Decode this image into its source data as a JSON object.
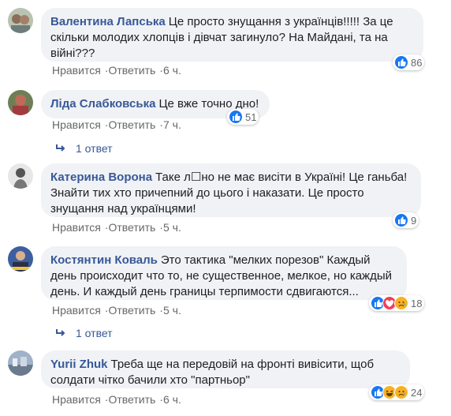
{
  "comments": [
    {
      "author": "Валентина Лапська",
      "text": "Це просто знущання з українців!!!!! За це скільки молодих хлопців і дівчат загинуло? На Майдані, та на війні???",
      "reactions_count": "86",
      "like_label": "Нравится",
      "reply_label": "Ответить",
      "time": "6 ч."
    },
    {
      "author": "Ліда Слабковська",
      "text": "Це вже точно дно!",
      "reactions_count": "51",
      "like_label": "Нравится",
      "reply_label": "Ответить",
      "time": "7 ч.",
      "replies_label": "1 ответ"
    },
    {
      "author": "Катерина Ворона",
      "text": "Таке л☐но не має висіти в Україні! Це ганьба! Знайти тих хто причепний до цього і наказати. Це просто знущання над українцями!",
      "reactions_count": "9",
      "like_label": "Нравится",
      "reply_label": "Ответить",
      "time": "5 ч."
    },
    {
      "author": "Костянтин Коваль",
      "text": "Это тактика \"мелких порезов\" Каждый день происходит что то, не существенное, мелкое, но каждый день. И каждый день границы терпимости сдвигаются...",
      "reactions_count": "18",
      "like_label": "Нравится",
      "reply_label": "Ответить",
      "time": "5 ч.",
      "replies_label": "1 ответ"
    },
    {
      "author": "Yurii Zhuk",
      "text": "Треба ще на передовій на фронті вивісити, щоб солдати чітко бачили хто \"партньор\"",
      "reactions_count": "24",
      "like_label": "Нравится",
      "reply_label": "Ответить",
      "time": "6 ч."
    }
  ],
  "colors": {
    "author": "#385898",
    "bubble": "#f0f2f5",
    "meta": "#65676b",
    "like": "#1877f2"
  },
  "icons": {
    "like": "thumbs-up-icon",
    "haha": "laughing-face-icon",
    "sad": "crying-face-icon",
    "love": "heart-eyes-icon",
    "reply": "reply-arrow-icon"
  }
}
